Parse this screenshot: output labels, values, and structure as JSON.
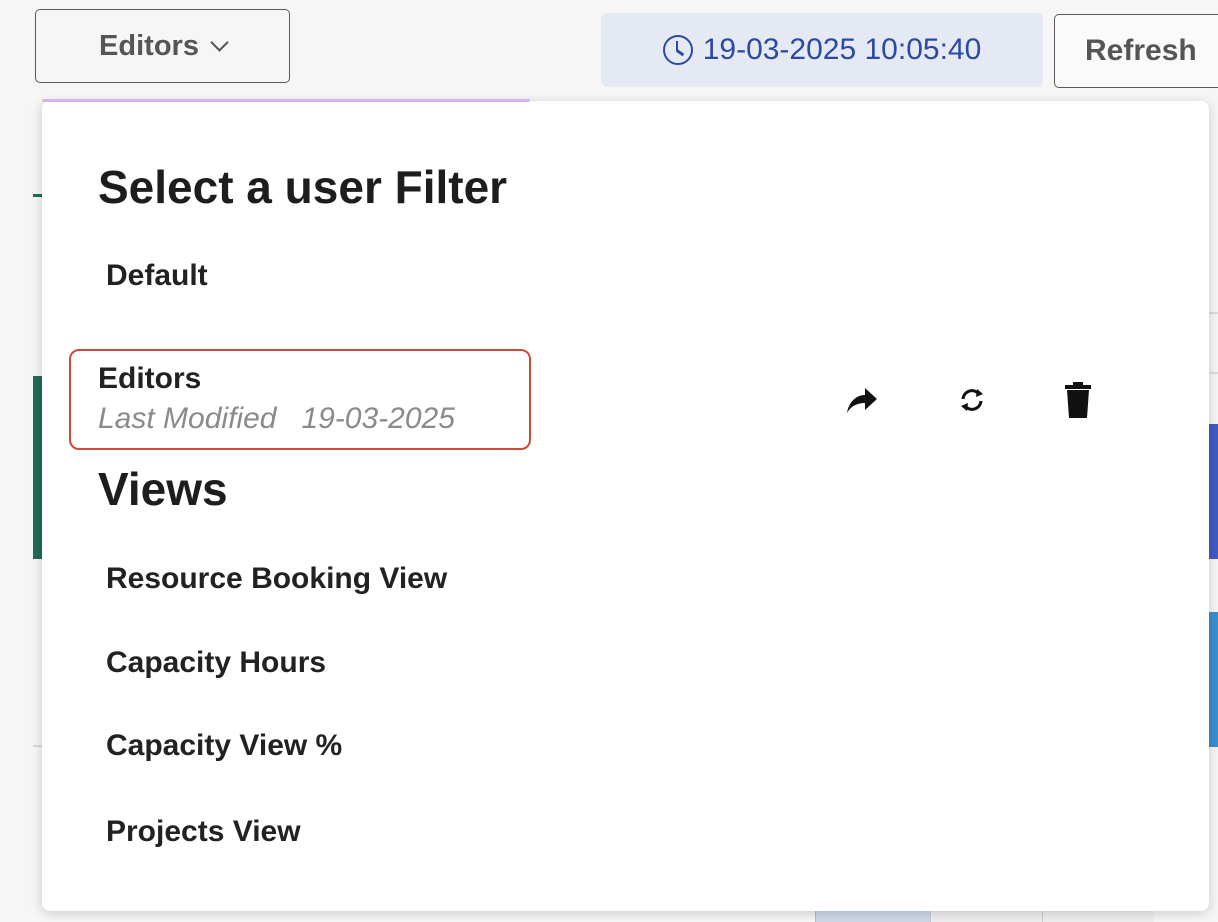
{
  "toolbar": {
    "filter_button_label": "Editors",
    "timestamp": "19-03-2025 10:05:40",
    "refresh_label": "Refresh"
  },
  "panel": {
    "title": "Select a user Filter",
    "filters": [
      {
        "label": "Default"
      }
    ],
    "selected_filter": {
      "name": "Editors",
      "meta": "Last Modified   19-03-2025"
    },
    "actions": {
      "share_icon": "share-icon",
      "sync_icon": "sync-icon",
      "delete_icon": "trash-icon"
    },
    "views_title": "Views",
    "views": [
      {
        "label": "Resource Booking View"
      },
      {
        "label": "Capacity Hours"
      },
      {
        "label": "Capacity View %"
      },
      {
        "label": "Projects View"
      }
    ]
  },
  "colors": {
    "highlight_border": "#d34a36",
    "timestamp_bg": "#e4e9f3",
    "timestamp_text": "#2d4aa3",
    "accent": "#d9b4ec"
  }
}
